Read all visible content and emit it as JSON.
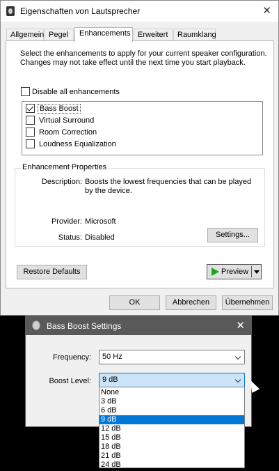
{
  "main_window": {
    "title": "Eigenschaften von Lautsprecher",
    "tabs": [
      {
        "label": "Allgemein",
        "active": false
      },
      {
        "label": "Pegel",
        "active": false
      },
      {
        "label": "Enhancements",
        "active": true
      },
      {
        "label": "Erweitert",
        "active": false
      },
      {
        "label": "Raumklang",
        "active": false
      }
    ],
    "intro_text": "Select the enhancements to apply for your current speaker configuration. Changes may not take effect until the next time you start playback.",
    "disable_all": {
      "label": "Disable all enhancements",
      "checked": false
    },
    "enhancements": [
      {
        "label": "Bass Boost",
        "checked": true,
        "selected": true
      },
      {
        "label": "Virtual Surround",
        "checked": false,
        "selected": false
      },
      {
        "label": "Room Correction",
        "checked": false,
        "selected": false
      },
      {
        "label": "Loudness Equalization",
        "checked": false,
        "selected": false
      }
    ],
    "properties": {
      "title": "Enhancement Properties",
      "description_label": "Description:",
      "description_value": "Boosts the lowest frequencies that can be played by the device.",
      "provider_label": "Provider:",
      "provider_value": "Microsoft",
      "status_label": "Status:",
      "status_value": "Disabled",
      "settings_button": "Settings..."
    },
    "restore_defaults": "Restore Defaults",
    "preview": "Preview",
    "ok": "OK",
    "cancel": "Abbrechen",
    "apply": "Übernehmen"
  },
  "bass_window": {
    "title": "Bass Boost Settings",
    "frequency_label": "Frequency:",
    "frequency_value": "50 Hz",
    "boost_label": "Boost Level:",
    "boost_value": "9 dB",
    "boost_options": [
      "None",
      "3 dB",
      "6 dB",
      "9 dB",
      "12 dB",
      "15 dB",
      "18 dB",
      "21 dB",
      "24 dB"
    ],
    "selected_option_index": 3
  },
  "colors": {
    "selection": "#0078d7",
    "bass_titlebar": "#595959",
    "preview_icon": "#1aa81a"
  }
}
